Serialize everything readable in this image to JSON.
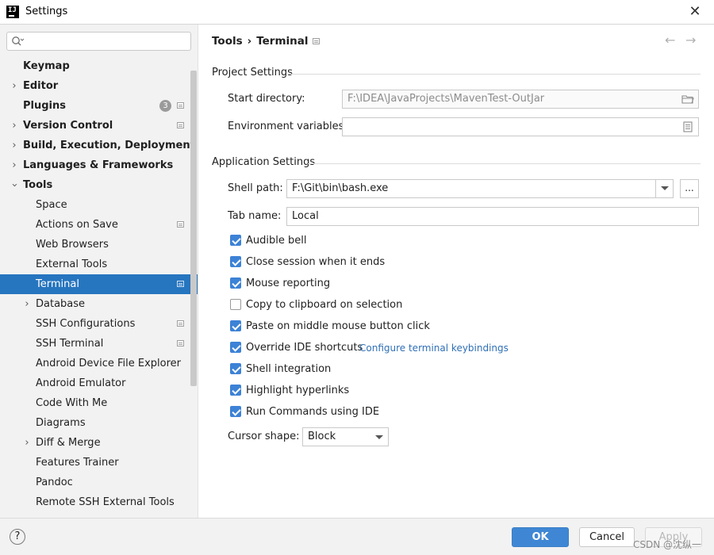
{
  "window": {
    "title": "Settings"
  },
  "sidebar": {
    "search": {
      "placeholder": ""
    },
    "items": [
      {
        "label": "Keymap"
      },
      {
        "label": "Editor"
      },
      {
        "label": "Plugins",
        "badge": "3"
      },
      {
        "label": "Version Control"
      },
      {
        "label": "Build, Execution, Deployment"
      },
      {
        "label": "Languages & Frameworks"
      },
      {
        "label": "Tools"
      },
      {
        "label": "Space"
      },
      {
        "label": "Actions on Save"
      },
      {
        "label": "Web Browsers"
      },
      {
        "label": "External Tools"
      },
      {
        "label": "Terminal"
      },
      {
        "label": "Database"
      },
      {
        "label": "SSH Configurations"
      },
      {
        "label": "SSH Terminal"
      },
      {
        "label": "Android Device File Explorer"
      },
      {
        "label": "Android Emulator"
      },
      {
        "label": "Code With Me"
      },
      {
        "label": "Diagrams"
      },
      {
        "label": "Diff & Merge"
      },
      {
        "label": "Features Trainer"
      },
      {
        "label": "Pandoc"
      },
      {
        "label": "Remote SSH External Tools"
      }
    ]
  },
  "breadcrumb": {
    "parent": "Tools",
    "separator": "›",
    "current": "Terminal"
  },
  "project_settings": {
    "title": "Project Settings",
    "start_directory_label": "Start directory:",
    "start_directory_value": "F:\\IDEA\\JavaProjects\\MavenTest-OutJar",
    "env_vars_label": "Environment variables:",
    "env_vars_value": ""
  },
  "application_settings": {
    "title": "Application Settings",
    "shell_path_label": "Shell path:",
    "shell_path_value": "F:\\Git\\bin\\bash.exe",
    "shell_browse": "...",
    "tab_name_label": "Tab name:",
    "tab_name_value": "Local",
    "checkboxes": [
      {
        "label": "Audible bell",
        "checked": true
      },
      {
        "label": "Close session when it ends",
        "checked": true
      },
      {
        "label": "Mouse reporting",
        "checked": true
      },
      {
        "label": "Copy to clipboard on selection",
        "checked": false
      },
      {
        "label": "Paste on middle mouse button click",
        "checked": true
      },
      {
        "label": "Override IDE shortcuts",
        "checked": true
      },
      {
        "label": "Shell integration",
        "checked": true
      },
      {
        "label": "Highlight hyperlinks",
        "checked": true
      },
      {
        "label": "Run Commands using IDE",
        "checked": true
      }
    ],
    "keybindings_link": "Configure terminal keybindings",
    "cursor_shape_label": "Cursor shape:",
    "cursor_shape_value": "Block"
  },
  "footer": {
    "help": "?",
    "ok": "OK",
    "cancel": "Cancel",
    "apply": "Apply",
    "watermark": "CSDN @沈纵一"
  },
  "colors": {
    "selection": "#2675bf",
    "primary_button": "#3f87d4",
    "checkbox": "#3c82d6",
    "link": "#2f6fb6"
  }
}
